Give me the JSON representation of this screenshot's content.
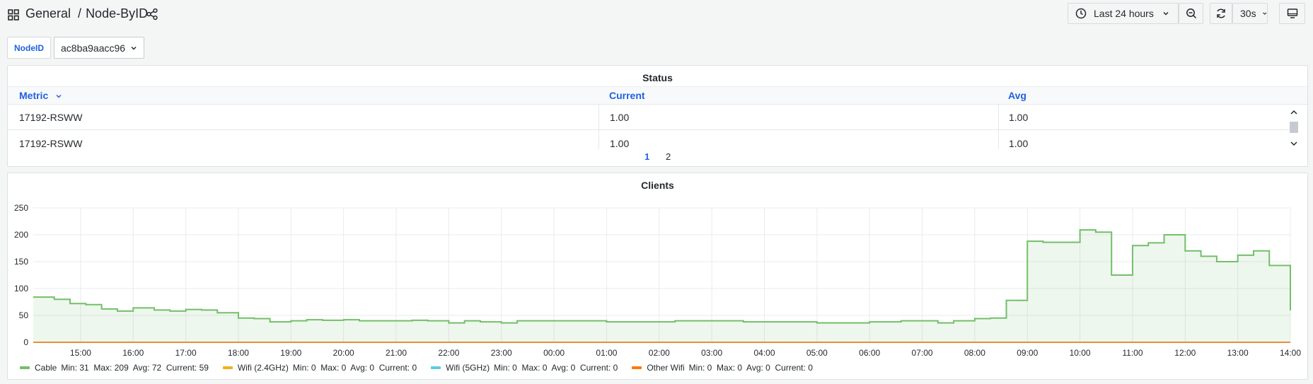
{
  "breadcrumb": {
    "folder": "General",
    "separator": "/",
    "dashboard": "Node-ByID"
  },
  "toolbar": {
    "time_range": "Last 24 hours",
    "refresh_interval": "30s"
  },
  "variables": [
    {
      "label": "NodeID",
      "value": "ac8ba9aacc96"
    }
  ],
  "status_panel": {
    "title": "Status",
    "columns": [
      "Metric",
      "Current",
      "Avg"
    ],
    "rows": [
      {
        "metric": "17192-RSWW",
        "current": "1.00",
        "avg": "1.00"
      },
      {
        "metric": "17192-RSWW",
        "current": "1.00",
        "avg": "1.00"
      }
    ],
    "pages": [
      "1",
      "2"
    ],
    "active_page": "1"
  },
  "clients_panel": {
    "title": "Clients",
    "legend": [
      {
        "name": "Cable",
        "color": "#73bf69",
        "stats": "Min: 31  Max: 209  Avg: 72  Current: 59"
      },
      {
        "name": "Wifi (2.4GHz)",
        "color": "#f2b01e",
        "stats": "Min: 0  Max: 0  Avg: 0  Current: 0"
      },
      {
        "name": "Wifi (5GHz)",
        "color": "#5ccbe6",
        "stats": "Min: 0  Max: 0  Avg: 0  Current: 0"
      },
      {
        "name": "Other Wifi",
        "color": "#ff780a",
        "stats": "Min: 0  Max: 0  Avg: 0  Current: 0"
      }
    ]
  },
  "chart_data": {
    "type": "area",
    "ylim": [
      0,
      250
    ],
    "yticks": [
      0,
      50,
      100,
      150,
      200,
      250
    ],
    "xticks": [
      "15:00",
      "16:00",
      "17:00",
      "18:00",
      "19:00",
      "20:00",
      "21:00",
      "22:00",
      "23:00",
      "00:00",
      "01:00",
      "02:00",
      "03:00",
      "04:00",
      "05:00",
      "06:00",
      "07:00",
      "08:00",
      "09:00",
      "10:00",
      "11:00",
      "12:00",
      "13:00",
      "14:00"
    ],
    "x_start_hour": 14.1,
    "x_end_hour": 38.0,
    "series": [
      {
        "name": "Cable",
        "color": "#73bf69",
        "points": [
          [
            14.1,
            84
          ],
          [
            14.5,
            80
          ],
          [
            14.8,
            72
          ],
          [
            15.1,
            70
          ],
          [
            15.4,
            62
          ],
          [
            15.7,
            58
          ],
          [
            16.0,
            64
          ],
          [
            16.4,
            60
          ],
          [
            16.7,
            58
          ],
          [
            17.0,
            61
          ],
          [
            17.3,
            60
          ],
          [
            17.6,
            55
          ],
          [
            18.0,
            45
          ],
          [
            18.3,
            44
          ],
          [
            18.6,
            38
          ],
          [
            19.0,
            40
          ],
          [
            19.3,
            42
          ],
          [
            19.6,
            41
          ],
          [
            20.0,
            42
          ],
          [
            20.3,
            40
          ],
          [
            20.6,
            40
          ],
          [
            21.0,
            40
          ],
          [
            21.3,
            41
          ],
          [
            21.6,
            40
          ],
          [
            22.0,
            36
          ],
          [
            22.3,
            40
          ],
          [
            22.6,
            38
          ],
          [
            23.0,
            36
          ],
          [
            23.3,
            40
          ],
          [
            23.6,
            40
          ],
          [
            24.0,
            40
          ],
          [
            24.3,
            40
          ],
          [
            24.6,
            40
          ],
          [
            25.0,
            38
          ],
          [
            25.3,
            38
          ],
          [
            25.6,
            38
          ],
          [
            26.0,
            38
          ],
          [
            26.3,
            40
          ],
          [
            26.6,
            40
          ],
          [
            27.0,
            40
          ],
          [
            27.3,
            40
          ],
          [
            27.6,
            38
          ],
          [
            28.0,
            38
          ],
          [
            28.3,
            38
          ],
          [
            28.6,
            38
          ],
          [
            29.0,
            36
          ],
          [
            29.3,
            36
          ],
          [
            29.6,
            36
          ],
          [
            30.0,
            38
          ],
          [
            30.3,
            38
          ],
          [
            30.6,
            40
          ],
          [
            31.0,
            40
          ],
          [
            31.3,
            36
          ],
          [
            31.6,
            40
          ],
          [
            32.0,
            44
          ],
          [
            32.3,
            45
          ],
          [
            32.6,
            78
          ],
          [
            33.0,
            188
          ],
          [
            33.3,
            186
          ],
          [
            33.6,
            186
          ],
          [
            34.0,
            209
          ],
          [
            34.3,
            205
          ],
          [
            34.6,
            125
          ],
          [
            35.0,
            180
          ],
          [
            35.3,
            185
          ],
          [
            35.6,
            200
          ],
          [
            36.0,
            170
          ],
          [
            36.3,
            160
          ],
          [
            36.6,
            150
          ],
          [
            37.0,
            162
          ],
          [
            37.3,
            170
          ],
          [
            37.6,
            143
          ],
          [
            38.0,
            59
          ]
        ]
      },
      {
        "name": "Wifi (2.4GHz)",
        "color": "#f2b01e",
        "points": [
          [
            14.1,
            0
          ],
          [
            38.0,
            0
          ]
        ]
      },
      {
        "name": "Wifi (5GHz)",
        "color": "#5ccbe6",
        "points": [
          [
            14.1,
            0
          ],
          [
            38.0,
            0
          ]
        ]
      },
      {
        "name": "Other Wifi",
        "color": "#ff780a",
        "points": [
          [
            14.1,
            0
          ],
          [
            38.0,
            0
          ]
        ]
      }
    ]
  }
}
